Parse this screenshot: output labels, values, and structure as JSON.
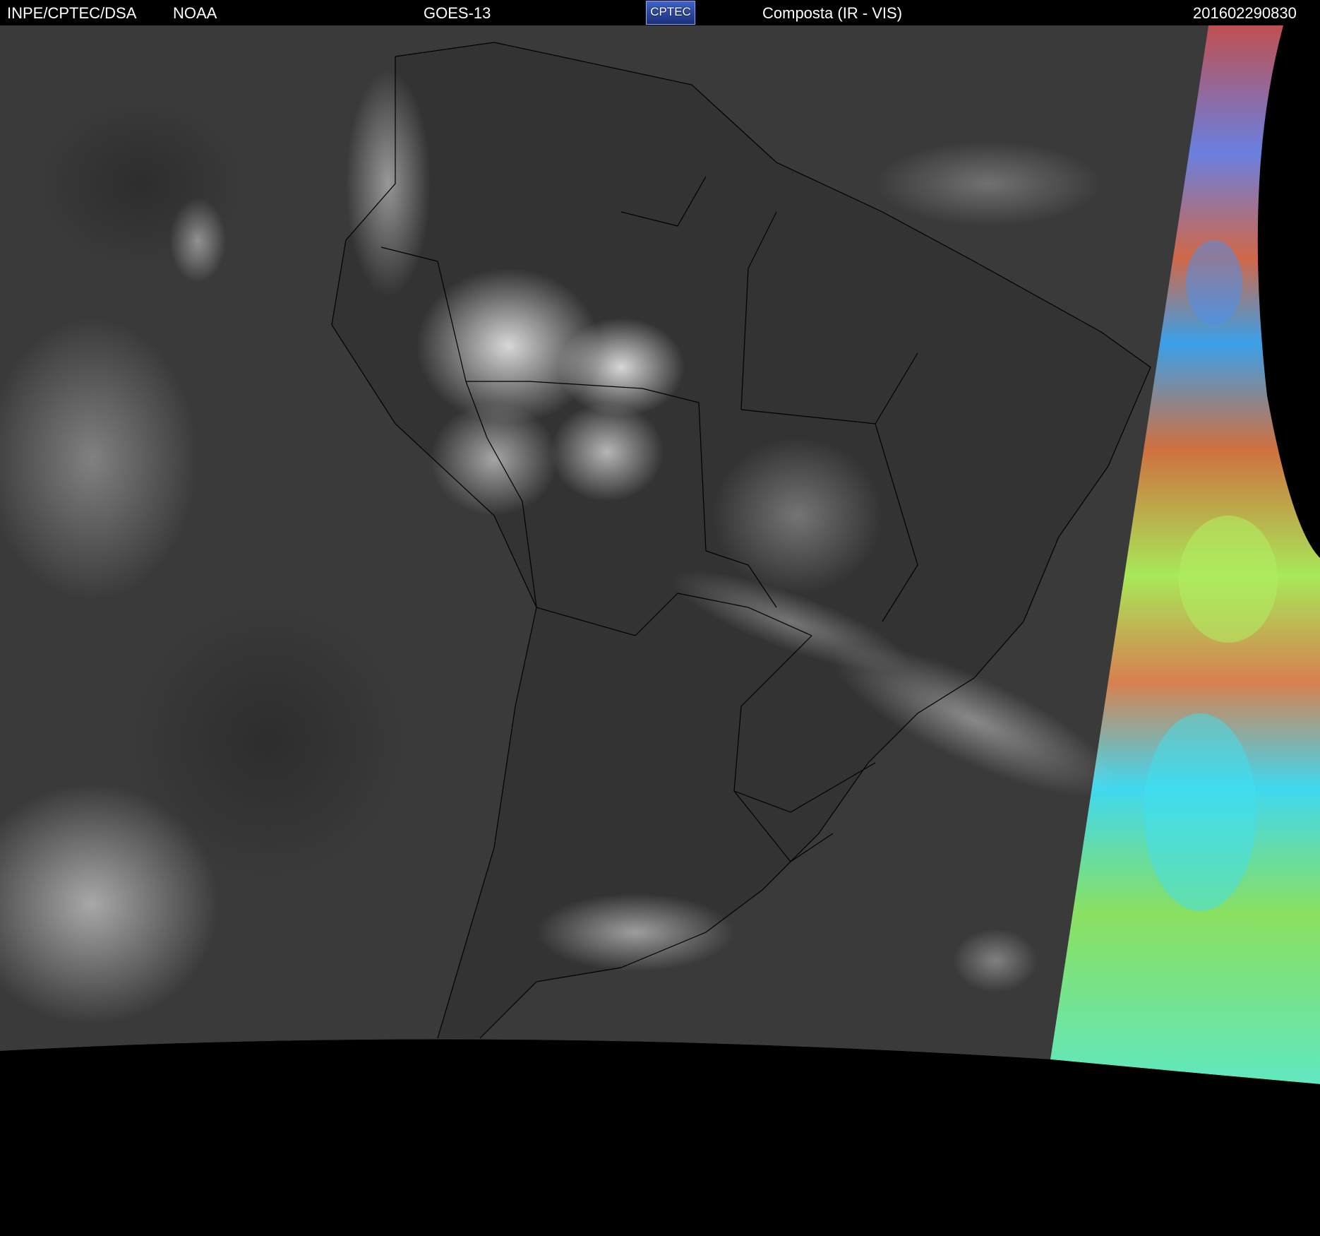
{
  "header": {
    "agency": "INPE/CPTEC/DSA",
    "partner": "NOAA",
    "satellite": "GOES-13",
    "logo_text": "CPTEC",
    "product": "Composta (IR - VIS)",
    "timestamp": "201602290830"
  },
  "colors": {
    "background": "#000000",
    "ocean": "#383838",
    "cloud": "#d8d8d8",
    "border_lines": "#000000",
    "ir_warm": "#e0704a",
    "ir_mid": "#a6e85a",
    "ir_cold": "#3fd8f0"
  }
}
